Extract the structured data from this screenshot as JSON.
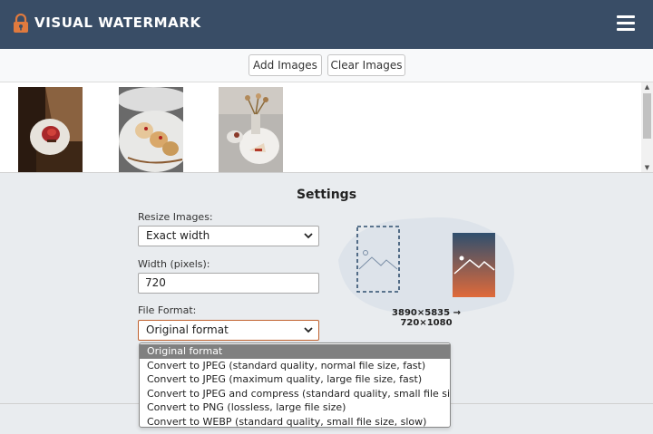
{
  "header": {
    "brand": "VISUAL WATERMARK",
    "brand_color": "#394d66",
    "logo_icon": "padlock-icon",
    "menu_icon": "hamburger-menu-icon"
  },
  "toolbar": {
    "add_images": "Add Images",
    "clear_images": "Clear Images"
  },
  "gallery": {
    "images": [
      {
        "alt": "dessert on wooden table"
      },
      {
        "alt": "pastries on plate"
      },
      {
        "alt": "cake slice with flowers"
      }
    ]
  },
  "settings": {
    "title": "Settings",
    "resize_label": "Resize Images:",
    "resize_value": "Exact width",
    "width_label": "Width (pixels):",
    "width_value": "720",
    "format_label": "File Format:",
    "format_value": "Original format",
    "dimensions": "3890×5835 → 720×1080"
  },
  "format_options": [
    "Original format",
    "Convert to JPEG (standard quality, normal file size, fast)",
    "Convert to JPEG (maximum quality, large file size, fast)",
    "Convert to JPEG and compress (standard quality, small file size, slow)",
    "Convert to PNG (lossless, large file size)",
    "Convert to WEBP (standard quality, small file size, slow)"
  ],
  "colors": {
    "accent": "#c0622f",
    "preview_top": "#2f4f6e",
    "preview_bottom": "#e06a3a"
  }
}
